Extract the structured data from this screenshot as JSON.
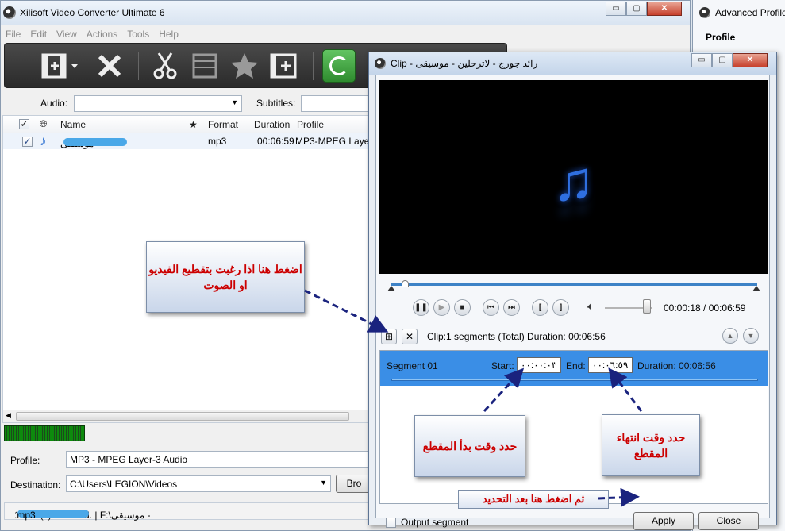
{
  "main_window": {
    "title": "Xilisoft Video Converter Ultimate 6",
    "window_buttons": [
      "▭",
      "▢",
      "✕"
    ]
  },
  "menubar": {
    "items": [
      "File",
      "Edit",
      "View",
      "Actions",
      "Tools",
      "Help"
    ]
  },
  "toolbar": {
    "icons": [
      "add-video-icon",
      "delete-icon",
      "clip-scissors-icon",
      "merge-film-icon",
      "effects-star-icon",
      "add-segment-icon",
      "convert-icon"
    ]
  },
  "av": {
    "audio_label": "Audio:",
    "audio_value": "",
    "subtitles_label": "Subtitles:",
    "subtitles_value": ""
  },
  "filelist": {
    "columns": {
      "name": "Name",
      "star": "★",
      "format": "Format",
      "duration": "Duration",
      "profile": "Profile"
    },
    "rows": [
      {
        "checked": true,
        "name": "موسيقى -",
        "format": "mp3",
        "duration": "00:06:59",
        "profile": "MP3-MPEG Layer"
      }
    ]
  },
  "bottom_form": {
    "profile_label": "Profile:",
    "profile_value": "MP3 - MPEG Layer-3 Audio",
    "destination_label": "Destination:",
    "destination_value": "C:\\Users\\LEGION\\Videos",
    "browse_label": "Bro"
  },
  "statusbar": {
    "text_prefix": "1 item(s) selected. | F:\\موسيقى -",
    "text_suffix": ".mp3"
  },
  "advanced_panel": {
    "title": "Advanced Profile",
    "profile_heading": "Profile"
  },
  "clip_dialog": {
    "title": "Clip - رائد جورج - لاترحلين - موسيقى",
    "window_buttons": [
      "▭",
      "▢",
      "✕"
    ],
    "time_display": "00:00:18 / 00:06:59",
    "clip_info": "Clip:1 segments (Total)  Duration: 00:06:56",
    "segment": {
      "name": "Segment 01",
      "start_label": "Start:",
      "start_value": "٠٠:٠٠:٠٣",
      "end_label": "End:",
      "end_value": "٠٠:٠٦:٥٩",
      "duration_label": "Duration: 00:06:56"
    },
    "output_label": "Output segment",
    "apply_label": "Apply",
    "close_label": "Close"
  },
  "annotations": {
    "clip_hint": "اضغط هنا اذا رغبت بتقطيع الفيديو او الصوت",
    "start_hint": "حدد وقت بدأ المقطع",
    "end_hint": "حدد وقت انتهاء المقطع",
    "apply_hint": "ثم اضغط هنا بعد التحديد"
  }
}
